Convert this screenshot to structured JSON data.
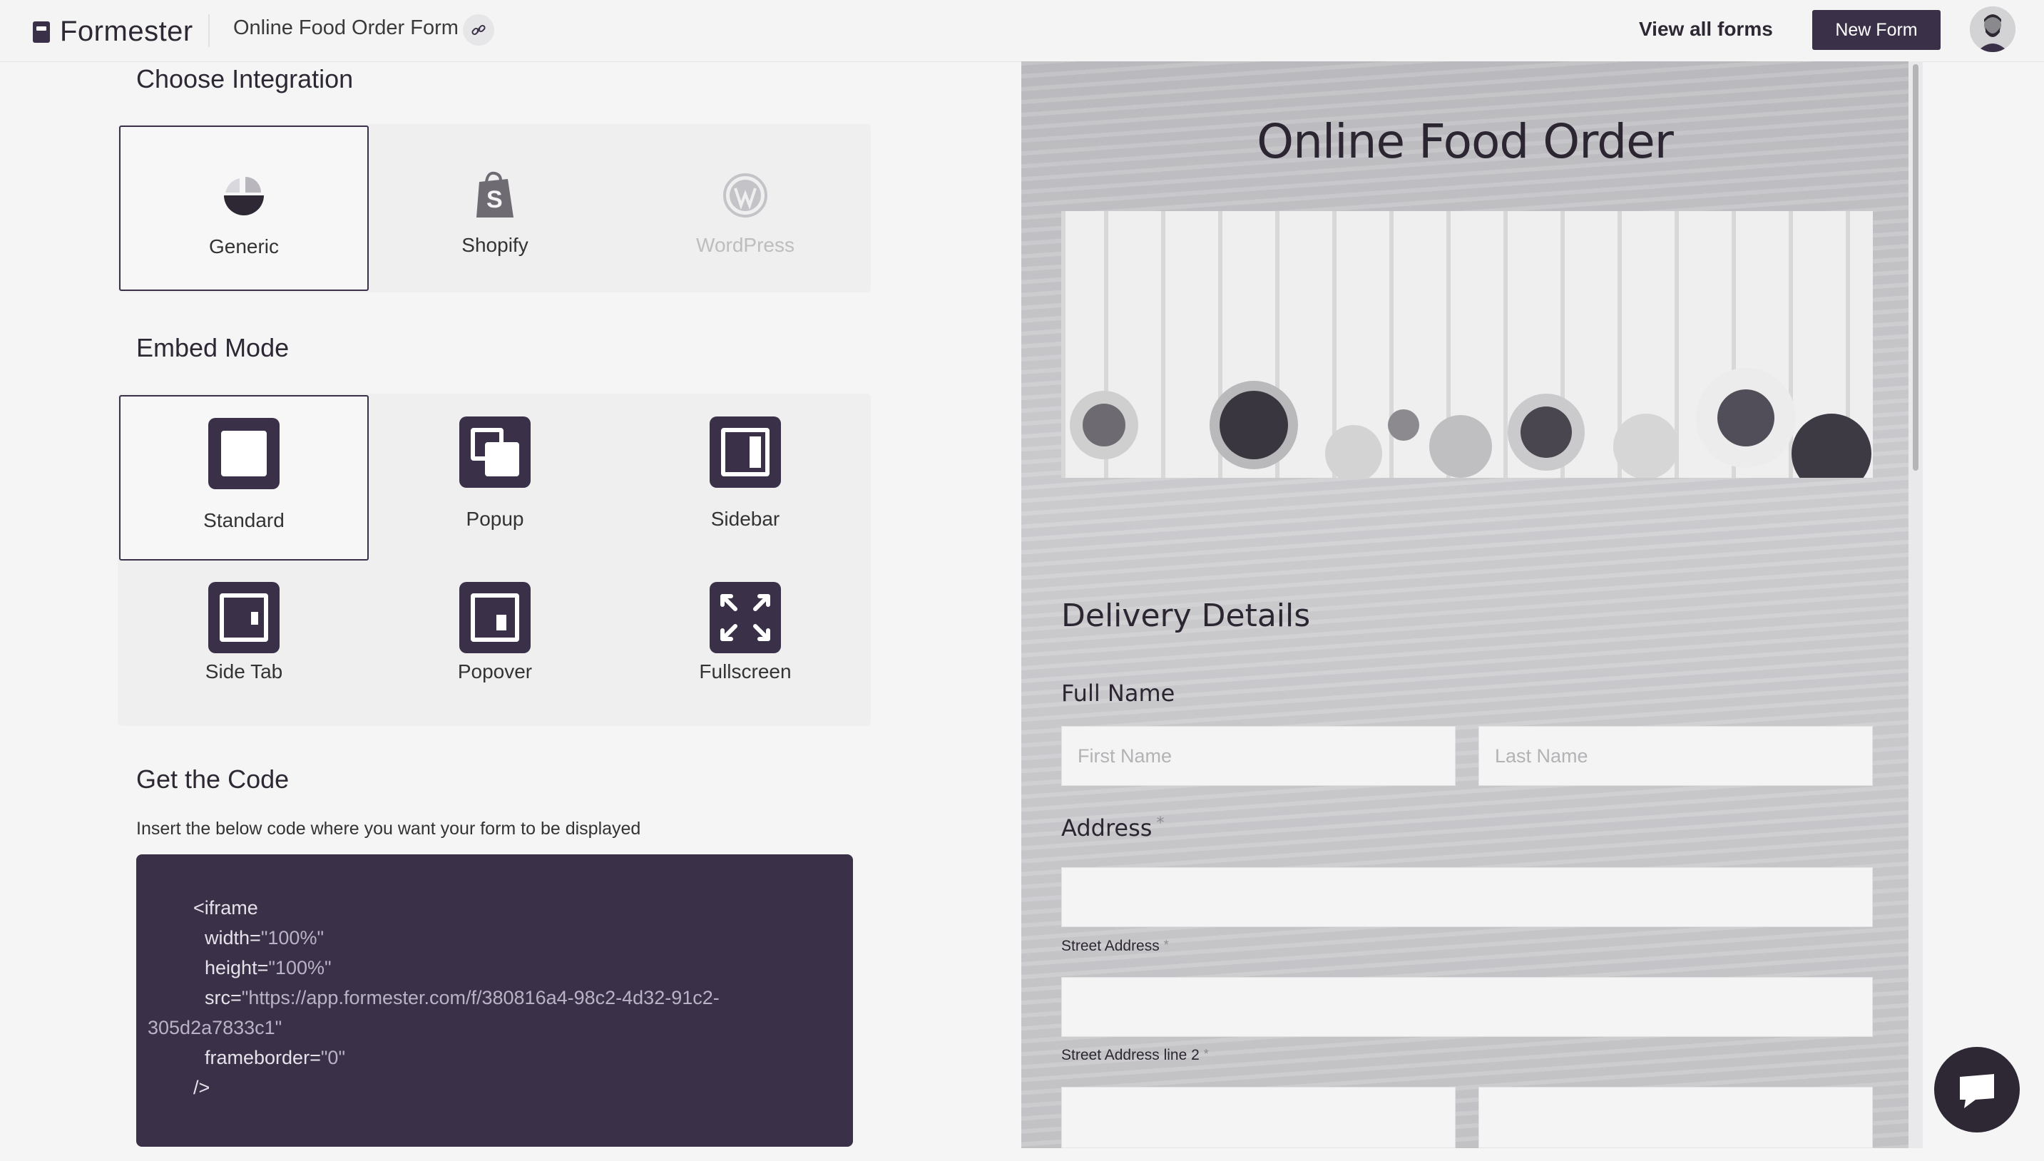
{
  "header": {
    "brand": "Formester",
    "form_title": "Online Food Order Form",
    "view_all": "View all forms",
    "new_form": "New Form"
  },
  "integration": {
    "title": "Choose Integration",
    "options": [
      {
        "label": "Generic",
        "icon": "generic-icon",
        "selected": true
      },
      {
        "label": "Shopify",
        "icon": "shopify-icon",
        "selected": false
      },
      {
        "label": "WordPress",
        "icon": "wordpress-icon",
        "selected": false
      }
    ]
  },
  "embed": {
    "title": "Embed Mode",
    "modes": [
      {
        "label": "Standard",
        "icon": "standard-mode-icon",
        "selected": true
      },
      {
        "label": "Popup",
        "icon": "popup-mode-icon",
        "selected": false
      },
      {
        "label": "Sidebar",
        "icon": "sidebar-mode-icon",
        "selected": false
      },
      {
        "label": "Side Tab",
        "icon": "side-tab-mode-icon",
        "selected": false
      },
      {
        "label": "Popover",
        "icon": "popover-mode-icon",
        "selected": false
      },
      {
        "label": "Fullscreen",
        "icon": "fullscreen-mode-icon",
        "selected": false
      }
    ]
  },
  "code": {
    "title": "Get the Code",
    "description": "Insert the below code where you want your form to be displayed",
    "lines": {
      "l1": "<iframe",
      "width_attr": "width=",
      "width_val": "\"100%\"",
      "height_attr": "height=",
      "height_val": "\"100%\"",
      "src_attr": "src=",
      "src_val_1": "\"https://app.formester.com/f/380816a4-98c2-4d32-91c2-",
      "src_val_2": "305d2a7833c1\"",
      "frameborder_attr": "frameborder=",
      "frameborder_val": "\"0\"",
      "close": "/>"
    }
  },
  "preview": {
    "title": "Online Food Order",
    "section": "Delivery Details",
    "full_name_label": "Full Name",
    "first_name_placeholder": "First Name",
    "last_name_placeholder": "Last Name",
    "address_label": "Address",
    "required_mark": "*",
    "street_address": "Street Address",
    "street_address_2": "Street Address line 2"
  },
  "colors": {
    "accent": "#3a3048",
    "background": "#f5f5f6"
  }
}
